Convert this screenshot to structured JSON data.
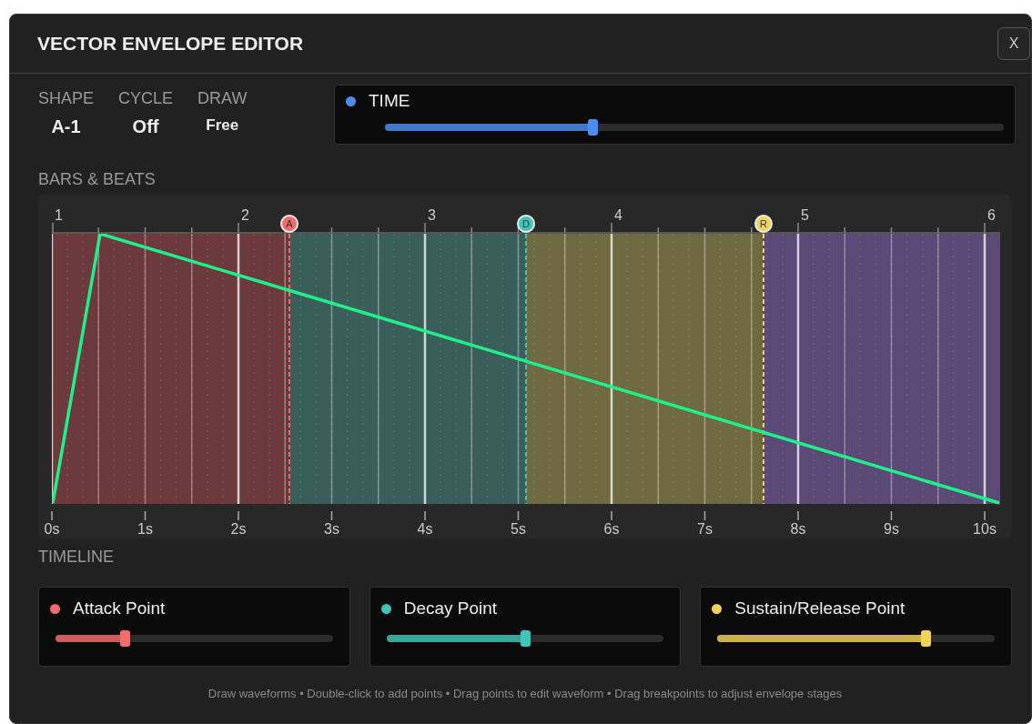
{
  "window": {
    "title": "VECTOR ENVELOPE EDITOR",
    "close": "X"
  },
  "stats": [
    {
      "label": "SHAPE",
      "value": "A-1"
    },
    {
      "label": "CYCLE",
      "value": "Off"
    },
    {
      "label": "DRAW",
      "value": "Free"
    }
  ],
  "time": {
    "label": "TIME",
    "color": "#4a8cf0",
    "level": 0.335
  },
  "bars_label": "BARS & BEATS",
  "bars": [
    "1",
    "2",
    "3",
    "4",
    "5",
    "6"
  ],
  "seconds": [
    "0s",
    "1s",
    "2s",
    "3s",
    "4s",
    "5s",
    "6s",
    "7s",
    "8s",
    "9s",
    "10s"
  ],
  "timeline_label": "TIMELINE",
  "timeline": [
    {
      "label": "Attack Point",
      "marker": "A",
      "color": "#f26b6b",
      "level": 0.25
    },
    {
      "label": "Decay Point",
      "marker": "D",
      "color": "#40c4b8",
      "level": 0.5
    },
    {
      "label": "Sustain/Release Point",
      "marker": "R",
      "color": "#f2d35a",
      "level": 0.75
    }
  ],
  "hint": "Draw waveforms • Double-click to add points • Drag points to edit waveform • Drag breakpoints to adjust envelope stages"
}
